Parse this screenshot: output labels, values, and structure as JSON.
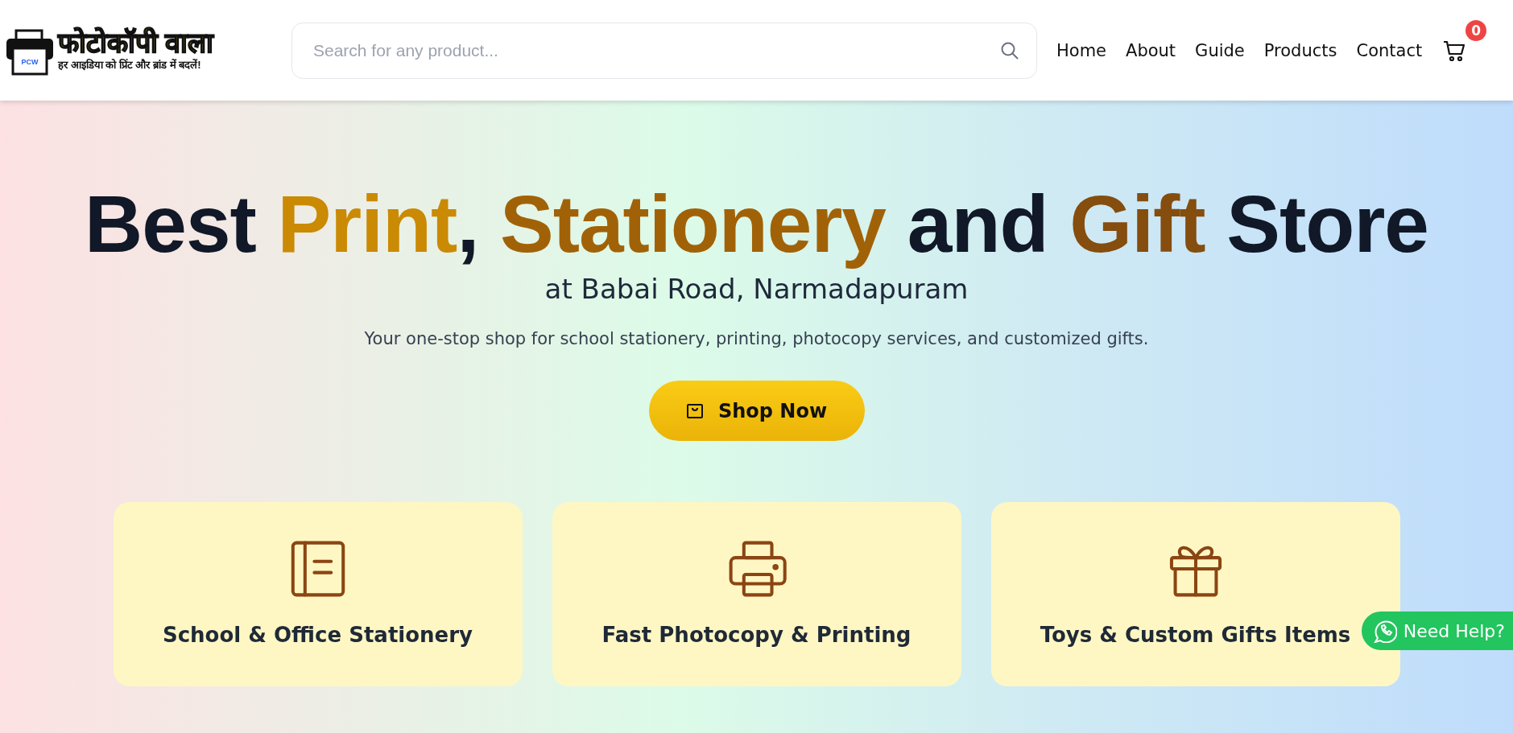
{
  "header": {
    "logo": {
      "title": "फोटोकॉपी वाला",
      "tagline": "हर आइडिया को प्रिंट और ब्रांड में बदलें!",
      "mark": "PCW"
    },
    "search": {
      "placeholder": "Search for any product..."
    },
    "nav": [
      "Home",
      "About",
      "Guide",
      "Products",
      "Contact"
    ],
    "cart": {
      "count": "0"
    }
  },
  "hero": {
    "title": [
      {
        "text": "Best ",
        "color": "#111827"
      },
      {
        "text": "Print",
        "color": "#ca8a04"
      },
      {
        "text": ", ",
        "color": "#111827"
      },
      {
        "text": "Stationery",
        "color": "#a16207"
      },
      {
        "text": " and ",
        "color": "#111827"
      },
      {
        "text": "Gift",
        "color": "#854d0e"
      },
      {
        "text": " Store",
        "color": "#111827"
      }
    ],
    "subtitle": "at Babai Road, Narmadapuram",
    "description": "Your one-stop shop for school stationery, printing, photocopy services, and customized gifts.",
    "button": "Shop Now"
  },
  "features": [
    {
      "kind": "book",
      "title": "School & Office Stationery"
    },
    {
      "kind": "printer",
      "title": "Fast Photocopy & Printing"
    },
    {
      "kind": "gift",
      "title": "Toys & Custom Gifts Items"
    }
  ],
  "help_button": "Need Help?"
}
